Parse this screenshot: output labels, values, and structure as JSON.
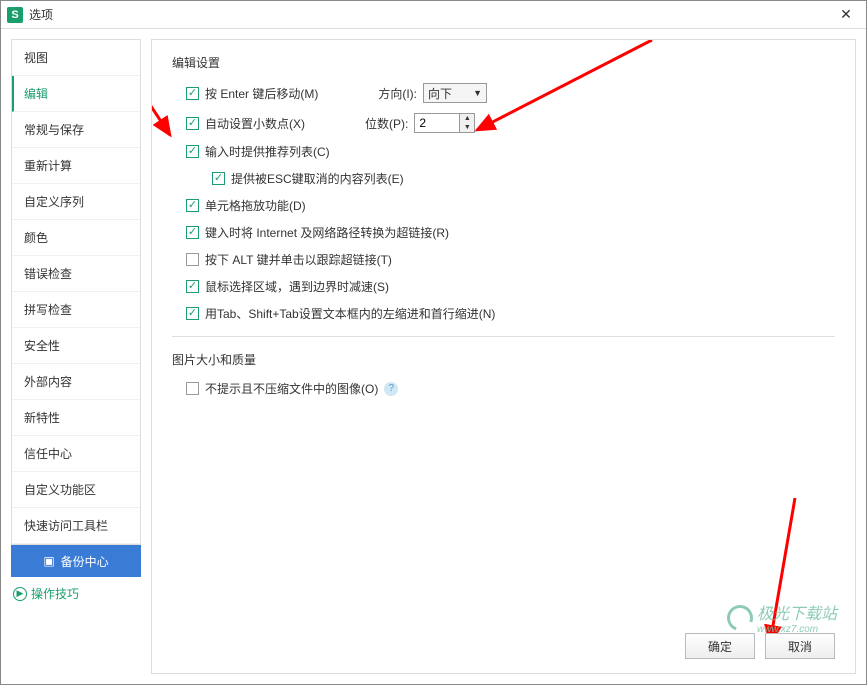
{
  "window": {
    "title": "选项",
    "app_icon_letter": "S"
  },
  "sidebar": {
    "items": [
      {
        "label": "视图"
      },
      {
        "label": "编辑",
        "active": true
      },
      {
        "label": "常规与保存"
      },
      {
        "label": "重新计算"
      },
      {
        "label": "自定义序列"
      },
      {
        "label": "颜色"
      },
      {
        "label": "错误检查"
      },
      {
        "label": "拼写检查"
      },
      {
        "label": "安全性"
      },
      {
        "label": "外部内容"
      },
      {
        "label": "新特性"
      },
      {
        "label": "信任中心"
      },
      {
        "label": "自定义功能区"
      },
      {
        "label": "快速访问工具栏"
      }
    ],
    "backup_label": "备份中心",
    "tips_label": "操作技巧"
  },
  "content": {
    "section1_title": "编辑设置",
    "row1": {
      "label": "按 Enter 键后移动(M)",
      "checked": true
    },
    "direction": {
      "label": "方向(I):",
      "value": "向下"
    },
    "row2": {
      "label": "自动设置小数点(X)",
      "checked": true
    },
    "digits": {
      "label": "位数(P):",
      "value": "2"
    },
    "row3": {
      "label": "输入时提供推荐列表(C)",
      "checked": true
    },
    "row3a": {
      "label": "提供被ESC键取消的内容列表(E)",
      "checked": true
    },
    "row4": {
      "label": "单元格拖放功能(D)",
      "checked": true
    },
    "row5": {
      "label": "键入时将 Internet 及网络路径转换为超链接(R)",
      "checked": true
    },
    "row6": {
      "label": "按下 ALT 键并单击以跟踪超链接(T)",
      "checked": false
    },
    "row7": {
      "label": "鼠标选择区域，遇到边界时减速(S)",
      "checked": true
    },
    "row8": {
      "label": "用Tab、Shift+Tab设置文本框内的左缩进和首行缩进(N)",
      "checked": true
    },
    "section2_title": "图片大小和质量",
    "row9": {
      "label": "不提示且不压缩文件中的图像(O)",
      "checked": false
    }
  },
  "footer": {
    "ok": "确定",
    "cancel": "取消"
  },
  "watermark": {
    "brand": "极光下载站",
    "url": "www.xz7.com"
  }
}
